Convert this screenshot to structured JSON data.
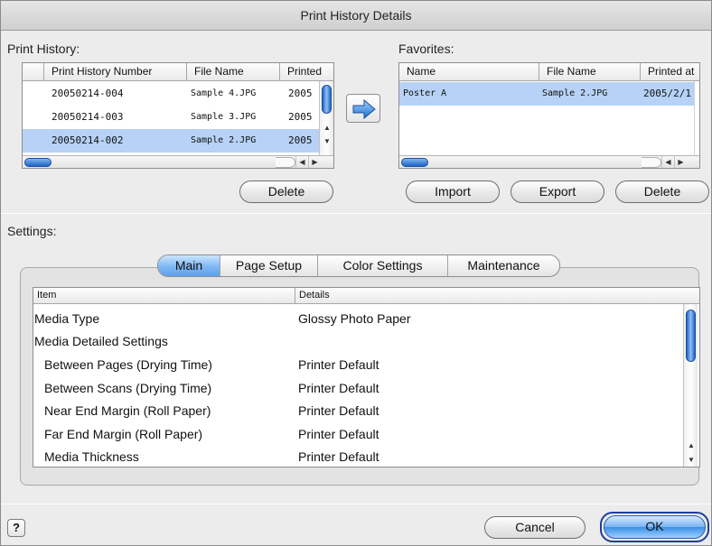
{
  "window": {
    "title": "Print History Details"
  },
  "print_history": {
    "label": "Print History:",
    "columns": [
      "Print History Number",
      "File Name",
      "Printed"
    ],
    "rows": [
      {
        "number": "20050214-004",
        "file": "Sample 4.JPG",
        "printed": "2005"
      },
      {
        "number": "20050214-003",
        "file": "Sample 3.JPG",
        "printed": "2005"
      },
      {
        "number": "20050214-002",
        "file": "Sample 2.JPG",
        "printed": "2005"
      }
    ],
    "delete_label": "Delete"
  },
  "favorites": {
    "label": "Favorites:",
    "columns": [
      "Name",
      "File Name",
      "Printed at"
    ],
    "rows": [
      {
        "name": "Poster A",
        "file": "Sample 2.JPG",
        "printed": "2005/2/1"
      }
    ],
    "import_label": "Import",
    "export_label": "Export",
    "delete_label": "Delete"
  },
  "settings": {
    "label": "Settings:",
    "tabs": [
      "Main",
      "Page Setup",
      "Color Settings",
      "Maintenance"
    ],
    "active_tab": "Main",
    "columns": [
      "Item",
      "Details"
    ],
    "rows": [
      {
        "item": "Media Type",
        "details": "Glossy Photo Paper",
        "indent": false
      },
      {
        "item": "Media Detailed Settings",
        "details": "",
        "indent": false
      },
      {
        "item": "Between Pages (Drying Time)",
        "details": "Printer Default",
        "indent": true
      },
      {
        "item": "Between Scans (Drying Time)",
        "details": "Printer Default",
        "indent": true
      },
      {
        "item": "Near End Margin (Roll Paper)",
        "details": "Printer Default",
        "indent": true
      },
      {
        "item": "Far End Margin (Roll Paper)",
        "details": "Printer Default",
        "indent": true
      },
      {
        "item": "Media Thickness",
        "details": "Printer Default",
        "indent": true
      }
    ]
  },
  "footer": {
    "help_glyph": "?",
    "cancel_label": "Cancel",
    "ok_label": "OK"
  },
  "icons": {
    "move_to_favorites": "right-arrow-icon",
    "help": "help-icon"
  },
  "colors": {
    "selection": "#b7d2f6",
    "accent_blue": "#3b8fe6"
  }
}
